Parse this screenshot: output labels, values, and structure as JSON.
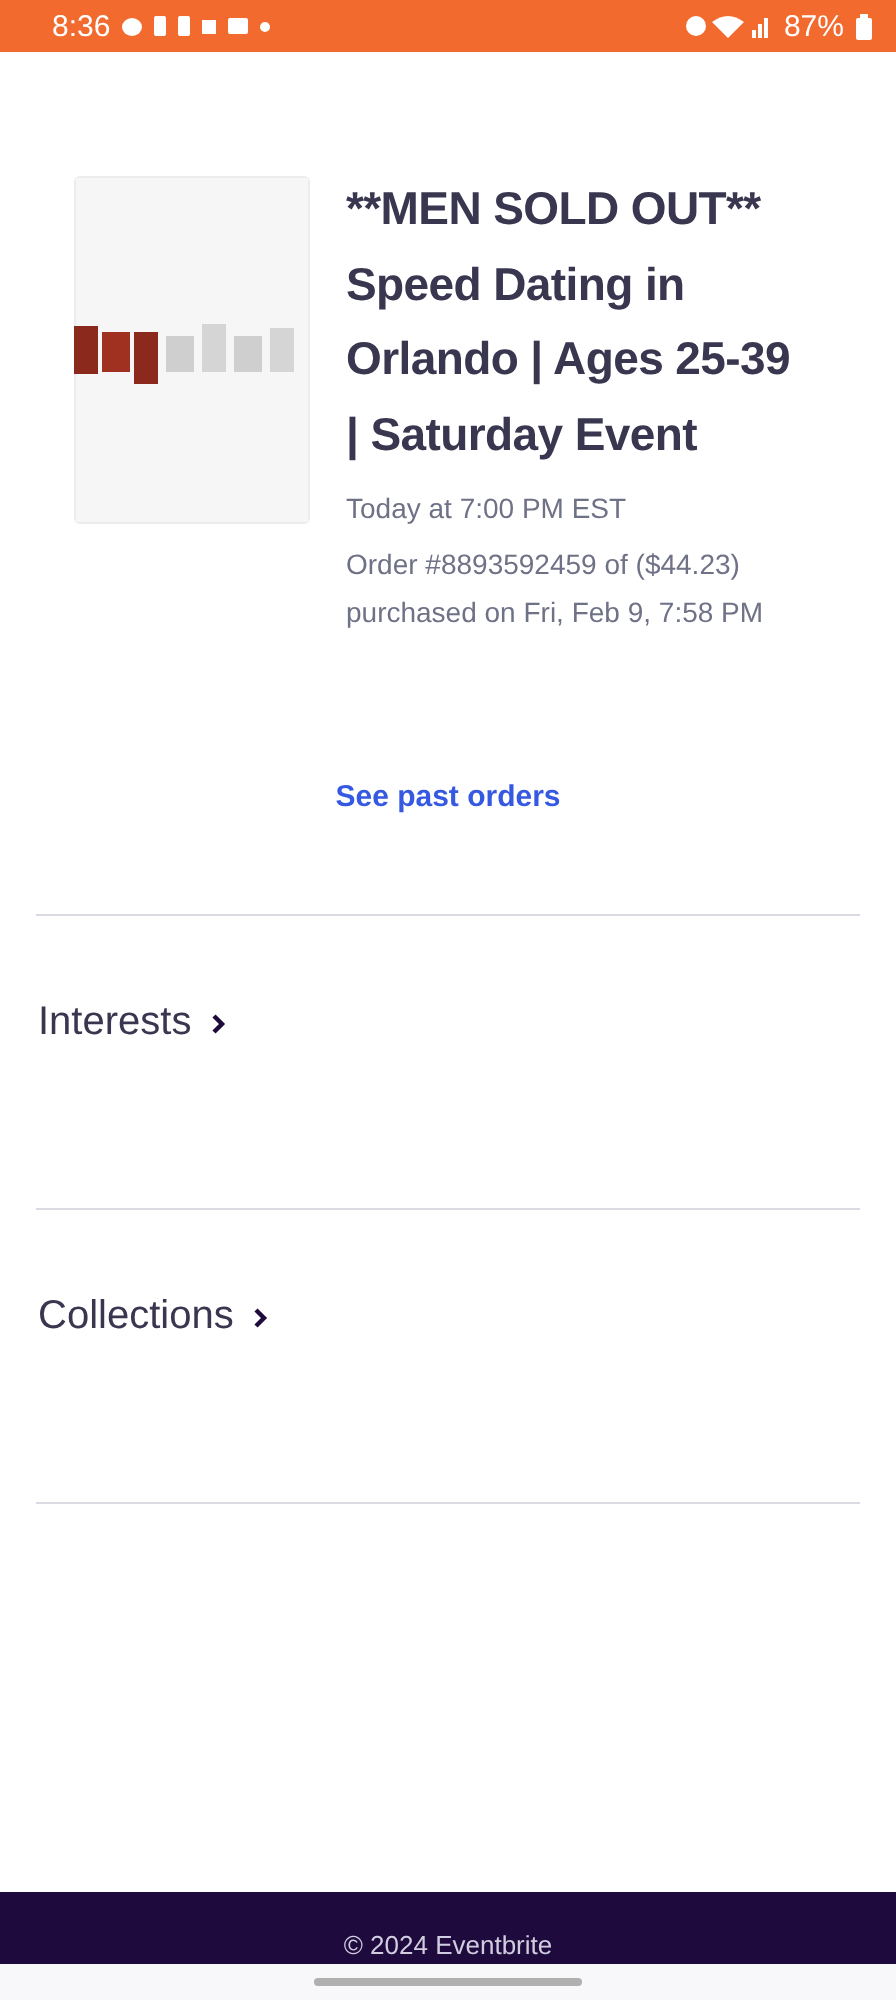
{
  "status_bar": {
    "time": "8:36",
    "battery": "87%"
  },
  "order": {
    "title": "**MEN SOLD OUT** Speed Dating in Orlando | Ages 25-39 | Saturday Event",
    "when": "Today at 7:00 PM EST",
    "details": "Order #8893592459 of ($44.23) purchased on Fri, Feb 9, 7:58 PM"
  },
  "past_orders_link": "See past orders",
  "sections": [
    {
      "label": "Interests"
    },
    {
      "label": "Collections"
    }
  ],
  "footer": "© 2024 Eventbrite"
}
